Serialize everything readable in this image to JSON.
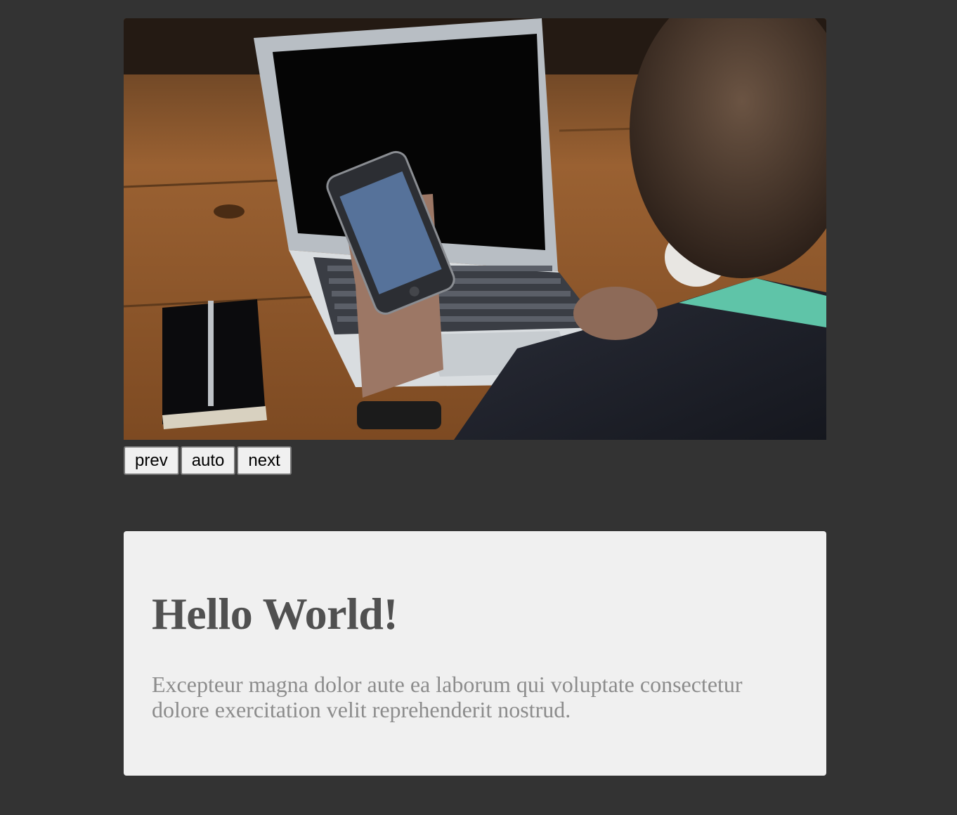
{
  "slider": {
    "image_alt": "person using phone with laptop",
    "controls": {
      "prev_label": "prev",
      "auto_label": "auto",
      "next_label": "next"
    }
  },
  "card": {
    "title": "Hello World!",
    "body": "Excepteur magna dolor aute ea laborum qui voluptate consectetur dolore exercitation velit reprehenderit nostrud."
  },
  "colors": {
    "page_background": "#333333",
    "card_background": "#f0f0f0",
    "title_color": "#505050",
    "body_color": "#8c8c8c"
  }
}
